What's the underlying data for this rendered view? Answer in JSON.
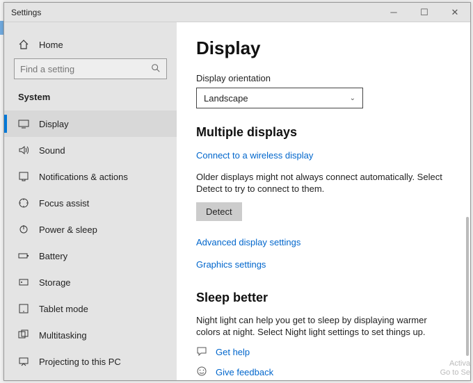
{
  "window": {
    "title": "Settings"
  },
  "sidebar": {
    "home": "Home",
    "search_placeholder": "Find a setting",
    "category": "System",
    "items": [
      {
        "label": "Display"
      },
      {
        "label": "Sound"
      },
      {
        "label": "Notifications & actions"
      },
      {
        "label": "Focus assist"
      },
      {
        "label": "Power & sleep"
      },
      {
        "label": "Battery"
      },
      {
        "label": "Storage"
      },
      {
        "label": "Tablet mode"
      },
      {
        "label": "Multitasking"
      },
      {
        "label": "Projecting to this PC"
      }
    ]
  },
  "content": {
    "title": "Display",
    "orientation_label": "Display orientation",
    "orientation_value": "Landscape",
    "multi_heading": "Multiple displays",
    "connect_link": "Connect to a wireless display",
    "older_text": "Older displays might not always connect automatically. Select Detect to try to connect to them.",
    "detect_btn": "Detect",
    "adv_link": "Advanced display settings",
    "gfx_link": "Graphics settings",
    "sleep_heading": "Sleep better",
    "sleep_text": "Night light can help you get to sleep by displaying warmer colors at night. Select Night light settings to set things up.",
    "help_link": "Get help",
    "feedback_link": "Give feedback"
  },
  "watermark": {
    "line1": "Activa",
    "line2": "Go to Se"
  }
}
